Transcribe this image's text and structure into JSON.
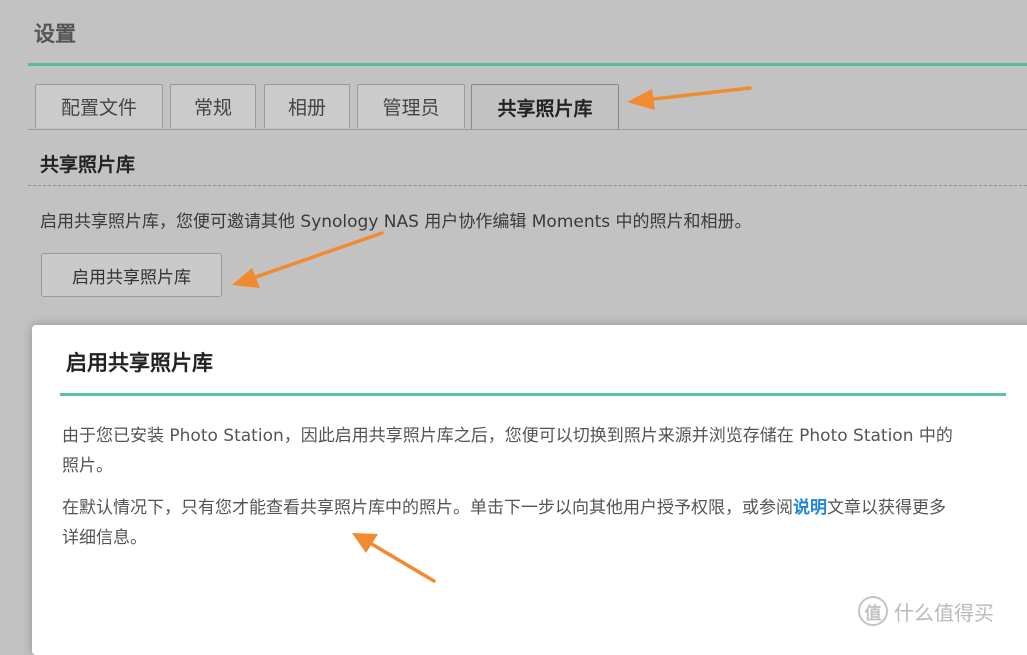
{
  "page": {
    "title": "设置"
  },
  "tabs": [
    {
      "label": "配置文件",
      "active": false
    },
    {
      "label": "常规",
      "active": false
    },
    {
      "label": "相册",
      "active": false
    },
    {
      "label": "管理员",
      "active": false
    },
    {
      "label": "共享照片库",
      "active": true
    }
  ],
  "section": {
    "title": "共享照片库",
    "description": "启用共享照片库，您便可邀请其他 Synology NAS 用户协作编辑 Moments 中的照片和相册。",
    "enable_button": "启用共享照片库"
  },
  "dialog": {
    "title": "启用共享照片库",
    "paragraph1": "由于您已安装 Photo Station，因此启用共享照片库之后，您便可以切换到照片来源并浏览存储在 Photo Station 中的照片。",
    "paragraph2_before": "在默认情况下，只有您才能查看共享照片库中的照片。单击下一步以向其他用户授予权限，或参阅",
    "paragraph2_link": "说明",
    "paragraph2_after": "文章以获得更多详细信息。"
  },
  "watermark": {
    "badge": "值",
    "text": "什么值得买"
  },
  "colors": {
    "accent": "#5bb8a2",
    "link": "#1e88d8",
    "annotation_arrow": "#f28a30",
    "backdrop": "#c2c2c2"
  }
}
